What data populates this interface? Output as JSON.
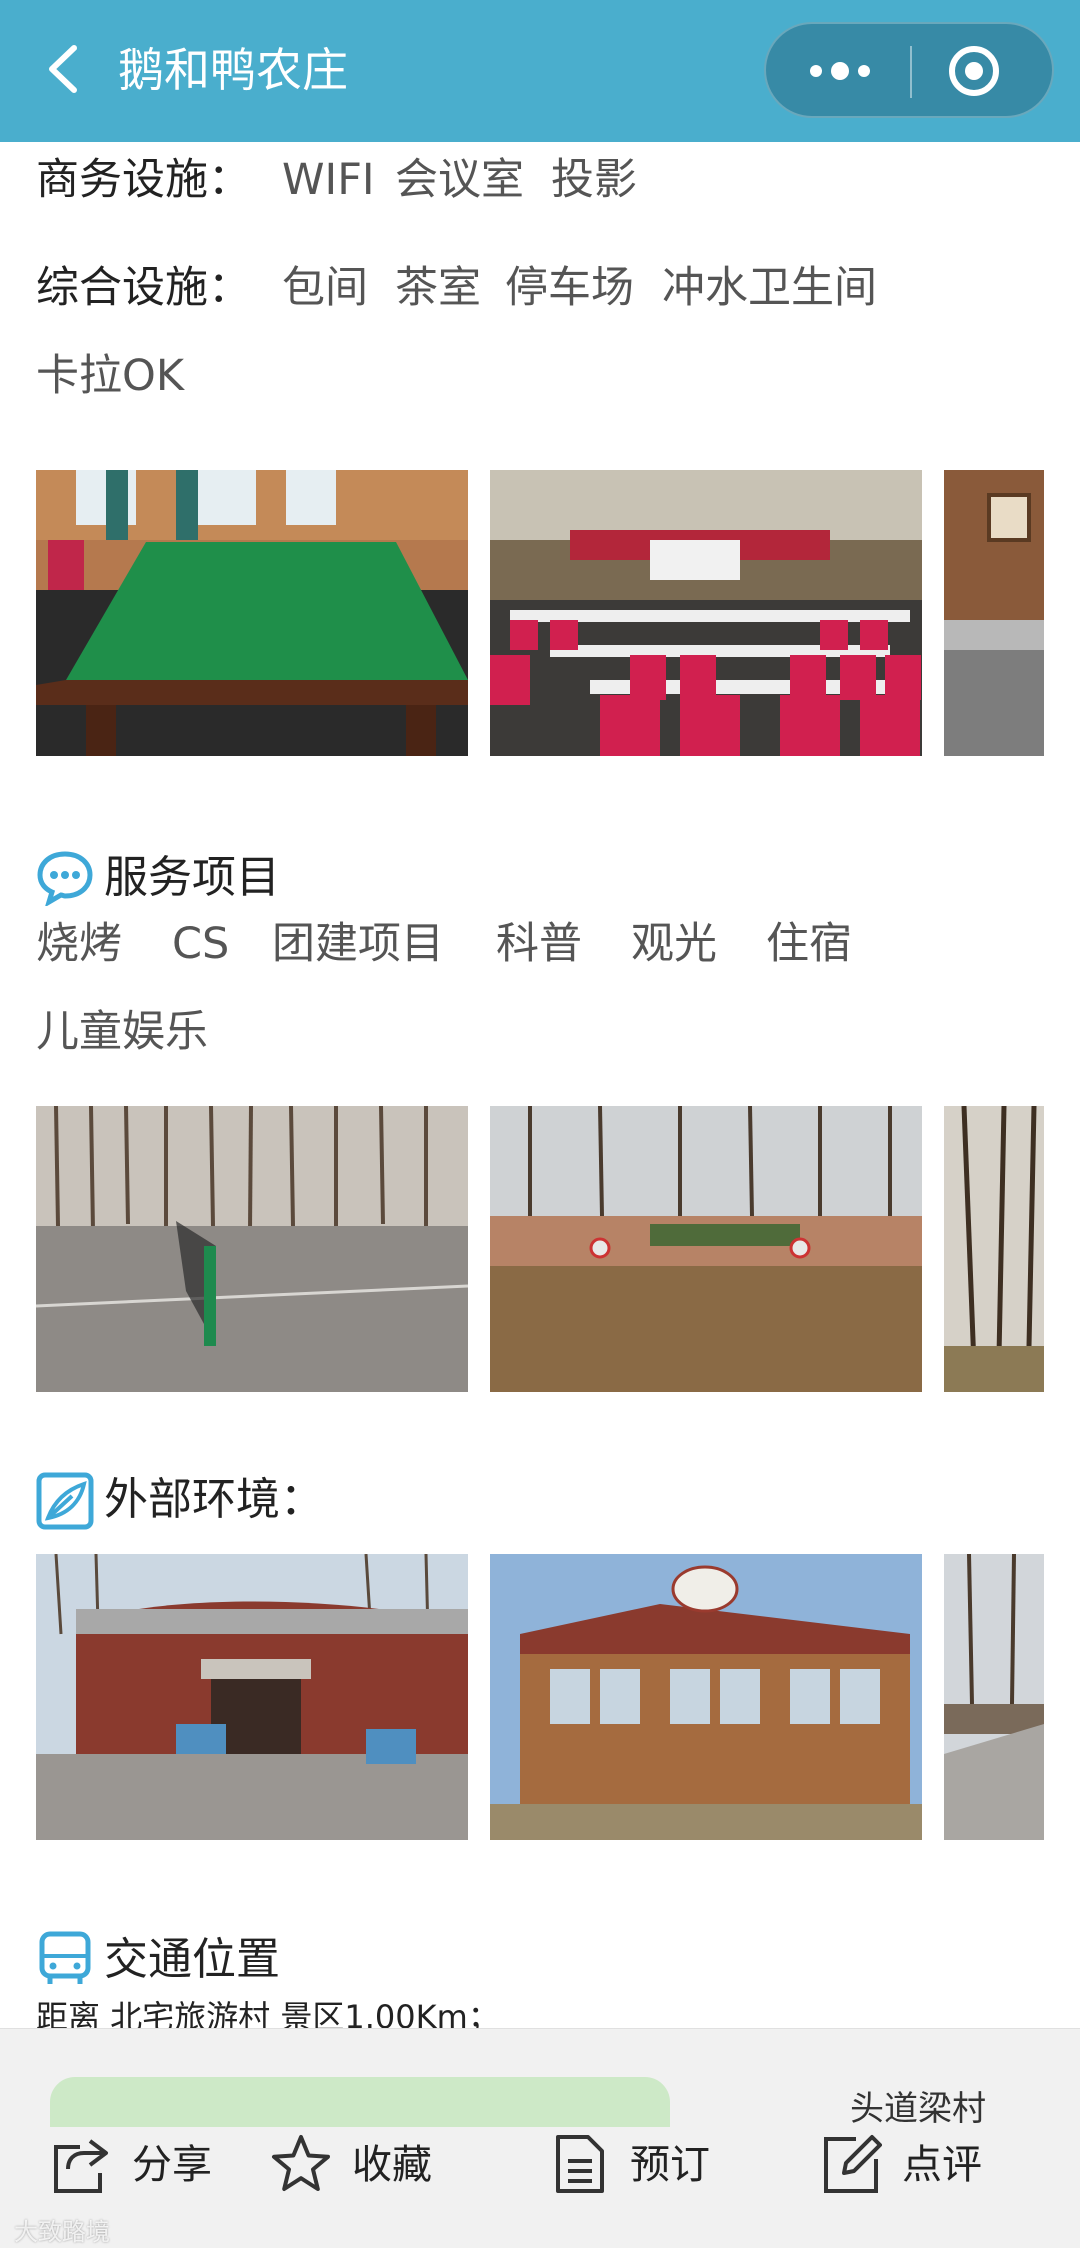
{
  "header": {
    "title": "鹅和鸭农庄",
    "bg_color": "#4aaecd"
  },
  "facilities": {
    "business_label": "商务设施：",
    "business_items": [
      "WIFI",
      "会议室",
      "投影"
    ],
    "general_label": "综合设施：",
    "general_items": [
      "包间",
      "茶室",
      "停车场",
      "冲水卫生间",
      "卡拉OK"
    ]
  },
  "photos_row1": [
    "billiards-room-photo",
    "conference-hall-photo",
    "bedroom-photo"
  ],
  "services": {
    "title": "服务项目",
    "icon": "chat-bubble-icon",
    "items": [
      "烧烤",
      "CS",
      "团建项目",
      "科普",
      "观光",
      "住宿",
      "儿童娱乐"
    ]
  },
  "photos_row2": [
    "tennis-court-photo",
    "archery-field-photo",
    "woods-photo"
  ],
  "environment": {
    "title": "外部环境：",
    "icon": "leaf-icon"
  },
  "photos_row3": [
    "building-exterior-photo",
    "village-inn-photo",
    "pathway-photo"
  ],
  "traffic": {
    "title": "交通位置",
    "icon": "bus-icon",
    "distance_text": "距离 北宅旅游村 景区1.00Km；"
  },
  "bottom_bar": {
    "map_label": "头道梁村",
    "share_label": "分享",
    "favorite_label": "收藏",
    "book_label": "预订",
    "review_label": "点评"
  },
  "watermark": "大致路境"
}
